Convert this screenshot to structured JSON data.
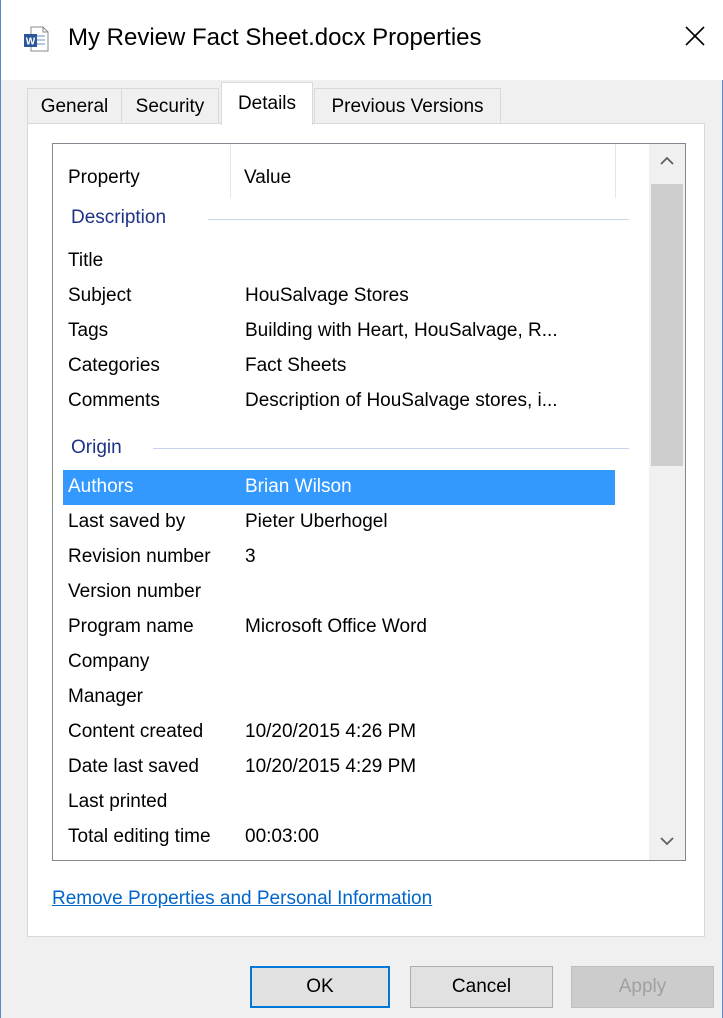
{
  "window": {
    "title": "My Review Fact Sheet.docx Properties",
    "icon": "word-document-icon"
  },
  "tabs": [
    {
      "label": "General"
    },
    {
      "label": "Security"
    },
    {
      "label": "Details",
      "active": true
    },
    {
      "label": "Previous Versions"
    }
  ],
  "list": {
    "columns": {
      "property": "Property",
      "value": "Value"
    },
    "groups": {
      "description": "Description",
      "origin": "Origin"
    },
    "description_rows": [
      {
        "key": "Title",
        "value": ""
      },
      {
        "key": "Subject",
        "value": "HouSalvage Stores"
      },
      {
        "key": "Tags",
        "value": "Building with Heart, HouSalvage, R..."
      },
      {
        "key": "Categories",
        "value": "Fact Sheets"
      },
      {
        "key": "Comments",
        "value": "Description of HouSalvage stores, i..."
      }
    ],
    "origin_rows": [
      {
        "key": "Authors",
        "value": "Brian Wilson",
        "selected": true
      },
      {
        "key": "Last saved by",
        "value": "Pieter Uberhogel"
      },
      {
        "key": "Revision number",
        "value": "3"
      },
      {
        "key": "Version number",
        "value": ""
      },
      {
        "key": "Program name",
        "value": "Microsoft Office Word"
      },
      {
        "key": "Company",
        "value": ""
      },
      {
        "key": "Manager",
        "value": ""
      },
      {
        "key": "Content created",
        "value": "10/20/2015 4:26 PM"
      },
      {
        "key": "Date last saved",
        "value": "10/20/2015 4:29 PM"
      },
      {
        "key": "Last printed",
        "value": ""
      },
      {
        "key": "Total editing time",
        "value": "00:03:00"
      }
    ]
  },
  "link": {
    "label": "Remove Properties and Personal Information"
  },
  "buttons": {
    "ok": "OK",
    "cancel": "Cancel",
    "apply": "Apply"
  },
  "colors": {
    "selection": "#3399ff",
    "group_header": "#1e3287",
    "link": "#0066cc",
    "focus_border": "#0078d7"
  }
}
